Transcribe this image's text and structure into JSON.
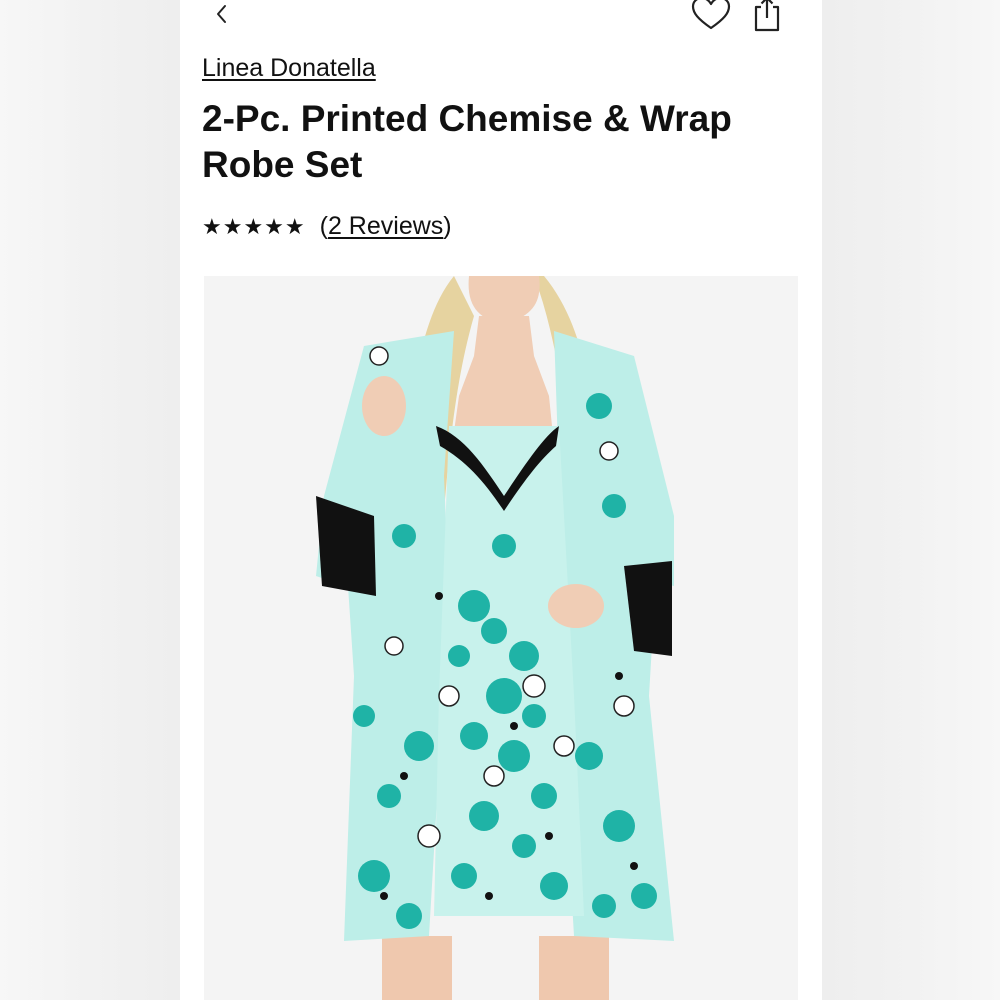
{
  "header": {
    "back_icon": "chevron-left-icon",
    "wishlist_icon": "heart-icon",
    "share_icon": "share-icon"
  },
  "product": {
    "brand": "Linea Donatella",
    "title": "2-Pc. Printed Chemise & Wrap Robe Set",
    "rating_stars": "★★★★★",
    "reviews_open": "(",
    "reviews_label": "2 Reviews",
    "reviews_close": ")",
    "image_alt": "Model wearing a mint and teal floral print chemise with black lace trim and matching wrap robe"
  },
  "colors": {
    "text": "#111111",
    "mint": "#bdeee8",
    "teal": "#1fb3a6",
    "lace": "#111111",
    "image_bg": "#f4f4f4"
  }
}
